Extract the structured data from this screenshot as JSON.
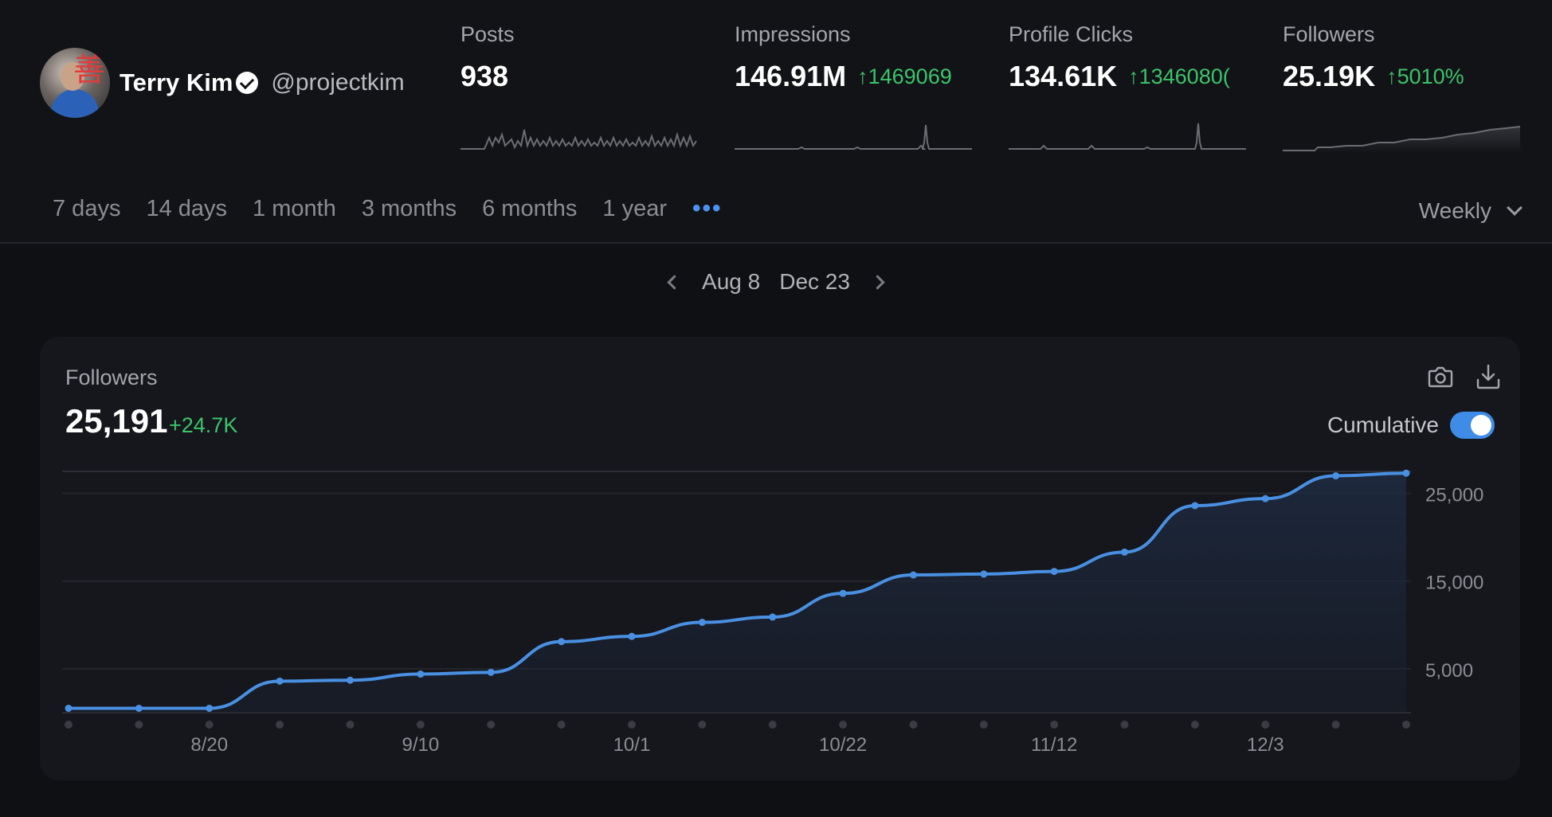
{
  "profile": {
    "name": "Terry Kim",
    "handle": "@projectkim",
    "avatar_glyph": "善"
  },
  "metrics": [
    {
      "label": "Posts",
      "value": "938",
      "delta": ""
    },
    {
      "label": "Impressions",
      "value": "146.91M",
      "delta": "1469069"
    },
    {
      "label": "Profile Clicks",
      "value": "134.61K",
      "delta": "1346080("
    },
    {
      "label": "Followers",
      "value": "25.19K",
      "delta": "5010%"
    }
  ],
  "periods": [
    "7 days",
    "14 days",
    "1 month",
    "3 months",
    "6 months",
    "1 year"
  ],
  "more_label": "•••",
  "granularity": "Weekly",
  "date_range": {
    "start": "Aug 8",
    "end": "Dec 23"
  },
  "card": {
    "title": "Followers",
    "value": "25,191",
    "delta": "+24.7K",
    "cumulative_label": "Cumulative",
    "cumulative_on": true
  },
  "colors": {
    "accent": "#4a90e2",
    "positive": "#3bc46a",
    "background": "#0f1013",
    "card": "#15171c"
  },
  "icons": {
    "delta": "arrow-up-icon",
    "screenshot": "camera-icon",
    "export": "download-icon"
  },
  "chart_data": {
    "type": "area",
    "x": [
      "8/6",
      "8/13",
      "8/20",
      "8/27",
      "9/3",
      "9/10",
      "9/17",
      "9/24",
      "10/1",
      "10/8",
      "10/15",
      "10/22",
      "10/29",
      "11/5",
      "11/12",
      "11/19",
      "11/26",
      "12/3",
      "12/10",
      "12/17"
    ],
    "x_tick_labels": [
      "8/20",
      "9/10",
      "10/1",
      "10/22",
      "11/12",
      "12/3"
    ],
    "series": [
      {
        "values": [
          500,
          500,
          500,
          3600,
          3700,
          4400,
          4600,
          8100,
          8700,
          10300,
          10900,
          13600,
          15700,
          15800,
          16100,
          18300,
          23600,
          24400,
          27000,
          27300
        ]
      }
    ],
    "y_ticks": [
      5000,
      15000,
      25000
    ],
    "y_tick_labels": [
      "5,000",
      "15,000",
      "25,000"
    ],
    "ylim": [
      0,
      27500
    ],
    "grid": true
  }
}
